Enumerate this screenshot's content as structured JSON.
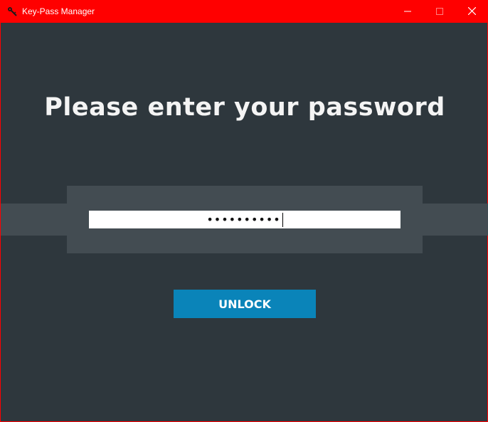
{
  "window": {
    "title": "Key-Pass Manager",
    "icon": "key-icon",
    "controls": {
      "minimize": "minimize-icon",
      "maximize": "maximize-icon",
      "close": "close-icon"
    },
    "titlebar_color": "#ff0000",
    "background_color": "#2e373d"
  },
  "main": {
    "heading": "Please enter your password",
    "password": {
      "masked_value": "••••••••••",
      "placeholder": ""
    },
    "unlock_label": "UNLOCK",
    "accent_color": "#0a84b9"
  }
}
